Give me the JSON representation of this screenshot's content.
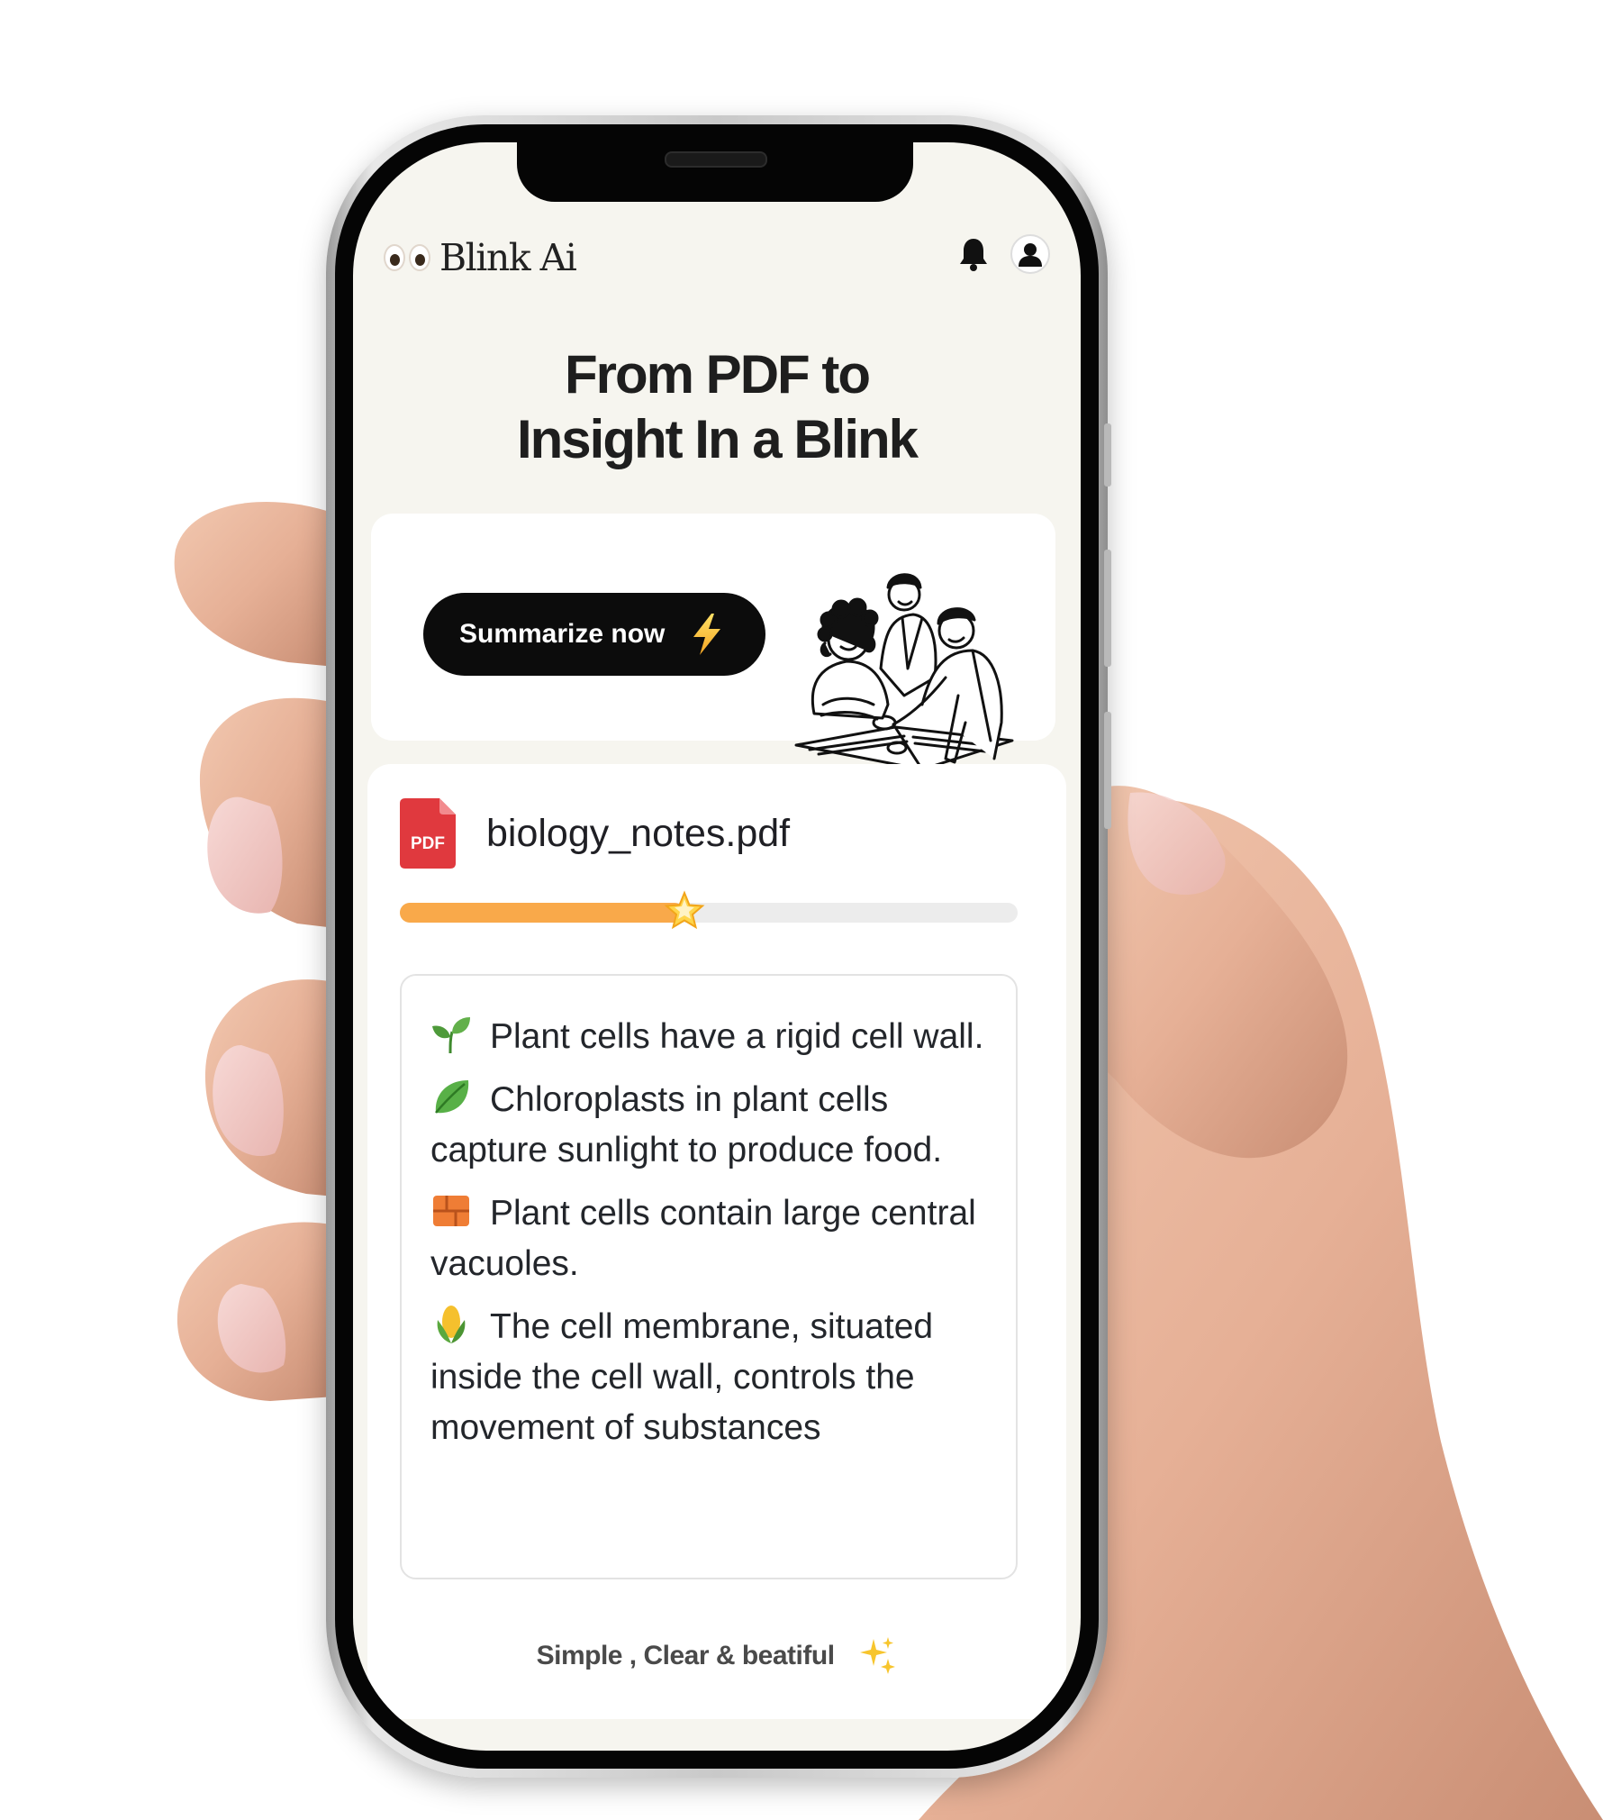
{
  "app": {
    "brand": "Blink Ai"
  },
  "header": {
    "icons": [
      "eyes-icon",
      "bell-icon",
      "user-avatar-icon"
    ]
  },
  "hero": {
    "headline_line1": "From PDF to",
    "headline_line2": "Insight In a Blink",
    "cta_label": "Summarize now",
    "cta_icon": "lightning-icon"
  },
  "file": {
    "icon_label": "PDF",
    "name": "biology_notes.pdf",
    "progress_percent": 46
  },
  "summary": {
    "bullets": [
      {
        "icon": "seedling-icon",
        "text": "Plant cells have a rigid cell wall."
      },
      {
        "icon": "leaf-icon",
        "text": "Chloroplasts in plant cells capture sunlight to produce food."
      },
      {
        "icon": "brick-icon",
        "text": "Plant cells contain large central vacuoles."
      },
      {
        "icon": "corn-icon",
        "text": "The cell membrane, situated inside the cell wall, controls the movement of substances"
      }
    ]
  },
  "footer": {
    "tagline": "Simple , Clear & beatiful",
    "icon": "sparkles-icon"
  },
  "colors": {
    "screen_bg": "#f6f5ef",
    "cta_bg": "#0c0c0c",
    "progress_fill": "#f9a94a",
    "progress_track": "#ececec",
    "pdf_red": "#e0393e"
  }
}
